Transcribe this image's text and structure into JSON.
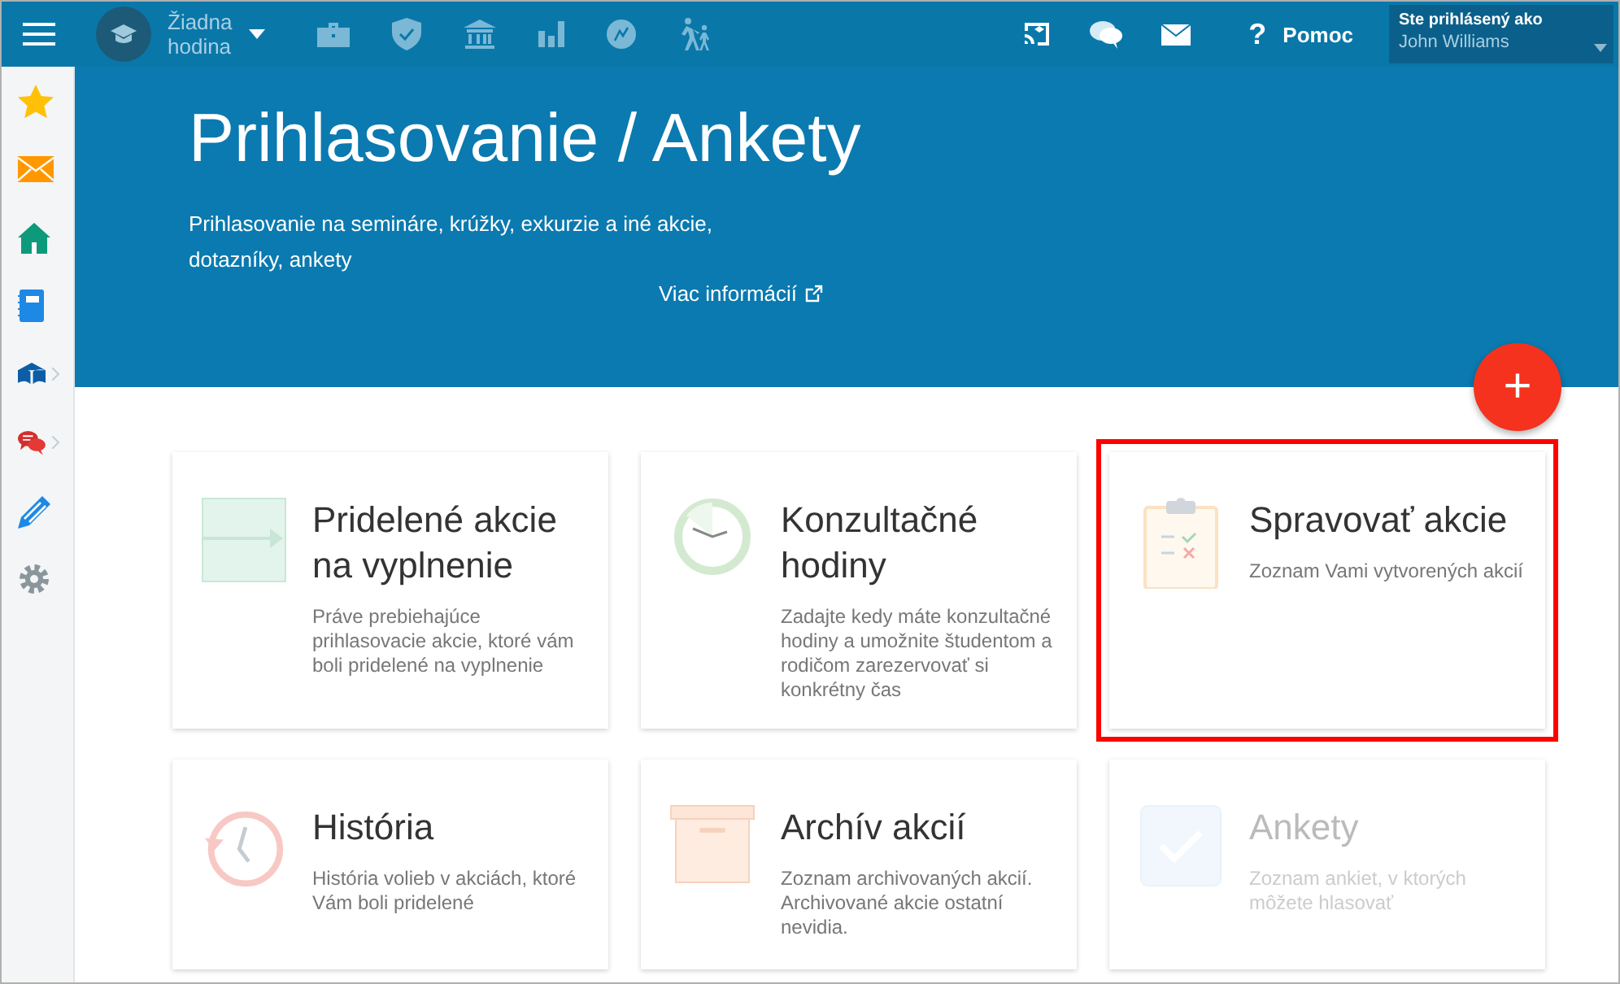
{
  "top_bar": {
    "lesson": {
      "label": "Žiadna hodina"
    },
    "modules": [
      {
        "kind": "briefcase"
      },
      {
        "kind": "shield"
      },
      {
        "kind": "bank"
      },
      {
        "kind": "chart"
      },
      {
        "kind": "badge"
      },
      {
        "kind": "walkers"
      }
    ],
    "actions": [
      {
        "kind": "cast"
      },
      {
        "kind": "chat"
      },
      {
        "kind": "mail"
      }
    ],
    "help": {
      "icon": "?",
      "label": "Pomoc"
    },
    "user": {
      "caption": "Ste prihlásený ako",
      "name": "John Williams"
    }
  },
  "sidebar": {
    "items": [
      {
        "kind": "star",
        "has_submenu": false
      },
      {
        "kind": "mail",
        "has_submenu": false
      },
      {
        "kind": "home",
        "has_submenu": false
      },
      {
        "kind": "notebook",
        "has_submenu": false
      },
      {
        "kind": "book",
        "has_submenu": true
      },
      {
        "kind": "chat",
        "has_submenu": true
      },
      {
        "kind": "pen",
        "has_submenu": false
      },
      {
        "kind": "gear",
        "has_submenu": false
      }
    ]
  },
  "hero": {
    "title": "Prihlasovanie / Ankety",
    "description": "Prihlasovanie na semináre, krúžky, exkurzie a iné akcie, dotazníky, ankety",
    "link": "Viac informácií",
    "add_button": "+"
  },
  "cards": [
    {
      "kind": "assigned",
      "title": "Pridelené akcie na vyplnenie",
      "description": "Práve prebiehajúce prihlasovacie akcie, ktoré vám boli pridelené na vyplnenie",
      "highlighted": false,
      "disabled": false
    },
    {
      "kind": "consult",
      "title": "Konzultačné hodiny",
      "description": "Zadajte kedy máte konzultačné hodiny a umožnite študentom a rodičom zarezervovať si konkrétny čas",
      "highlighted": false,
      "disabled": false
    },
    {
      "kind": "manage",
      "title": "Spravovať akcie",
      "description": "Zoznam Vami vytvorených akcií",
      "highlighted": true,
      "disabled": false
    },
    {
      "kind": "history",
      "title": "História",
      "description": "História volieb v akciách, ktoré Vám boli pridelené",
      "highlighted": false,
      "disabled": false
    },
    {
      "kind": "archive",
      "title": "Archív akcií",
      "description": "Zoznam archivovaných akcií. Archivované akcie ostatní nevidia.",
      "highlighted": false,
      "disabled": false
    },
    {
      "kind": "polls",
      "title": "Ankety",
      "description": "Zoznam ankiet, v ktorých môžete hlasovať",
      "highlighted": false,
      "disabled": true
    }
  ]
}
